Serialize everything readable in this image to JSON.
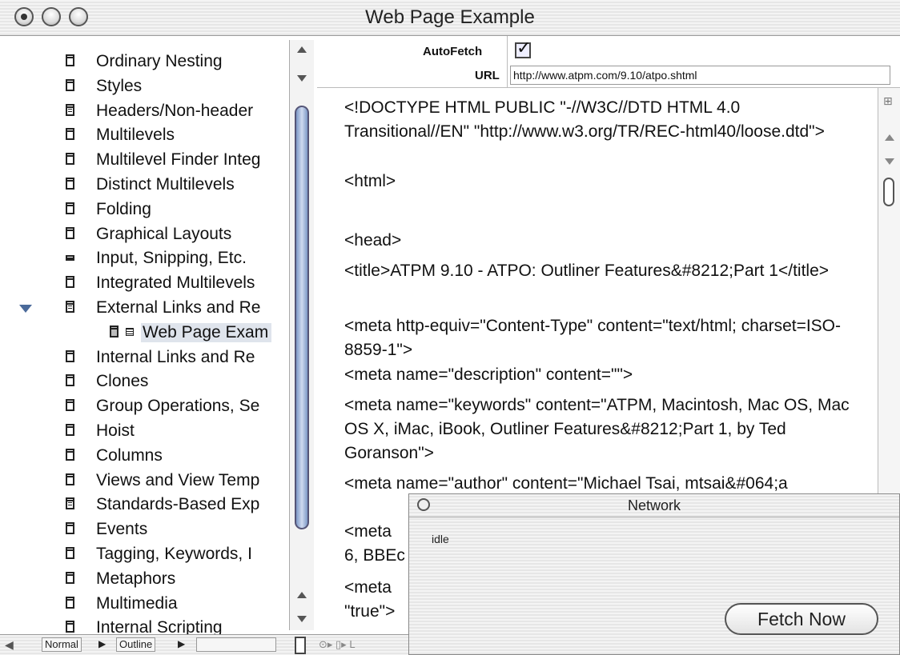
{
  "window": {
    "title": "Web Page Example"
  },
  "outline": {
    "items": [
      {
        "label": "Ordinary Nesting",
        "icon": "document-icon"
      },
      {
        "label": "Styles",
        "icon": "document-icon"
      },
      {
        "label": "Headers/Non-header",
        "icon": "document-filled-icon"
      },
      {
        "label": "Multilevels",
        "icon": "document-icon"
      },
      {
        "label": "Multilevel Finder Integ",
        "icon": "document-icon"
      },
      {
        "label": "Distinct Multilevels",
        "icon": "document-icon"
      },
      {
        "label": "Folding",
        "icon": "document-icon"
      },
      {
        "label": "Graphical Layouts",
        "icon": "document-icon"
      },
      {
        "label": "Input, Snipping, Etc.",
        "icon": "collapsed-document-icon"
      },
      {
        "label": "Integrated Multilevels",
        "icon": "document-icon"
      },
      {
        "label": "External Links and Re",
        "icon": "document-filled-icon",
        "expanded": true
      },
      {
        "label": "Web Page Exam",
        "icon": "web-page-icon",
        "child": true,
        "selected": true
      },
      {
        "label": "Internal Links and Re",
        "icon": "document-icon"
      },
      {
        "label": "Clones",
        "icon": "document-icon"
      },
      {
        "label": "Group Operations, Se",
        "icon": "document-icon"
      },
      {
        "label": "Hoist",
        "icon": "document-icon"
      },
      {
        "label": "Columns",
        "icon": "document-icon"
      },
      {
        "label": "Views and View Temp",
        "icon": "document-icon"
      },
      {
        "label": "Standards-Based Exp",
        "icon": "document-filled-icon"
      },
      {
        "label": "Events",
        "icon": "document-icon"
      },
      {
        "label": "Tagging, Keywords, I",
        "icon": "document-icon"
      },
      {
        "label": "Metaphors",
        "icon": "document-icon"
      },
      {
        "label": "Multimedia",
        "icon": "document-icon"
      },
      {
        "label": "Internal Scripting",
        "icon": "document-icon"
      }
    ]
  },
  "fields": {
    "autofetch_label": "AutoFetch",
    "autofetch_checked": true,
    "url_label": "URL",
    "url_value": "http://www.atpm.com/9.10/atpo.shtml"
  },
  "content": {
    "lines": [
      "<!DOCTYPE HTML PUBLIC \"-//W3C//DTD HTML 4.0 Transitional//EN\" \"http://www.w3.org/TR/REC-html40/loose.dtd\">",
      "<html>",
      "<head>",
      "<title>ATPM 9.10 - ATPO: Outliner Features&#8212;Part 1</title>",
      "<meta http-equiv=\"Content-Type\" content=\"text/html; charset=ISO-8859-1\">",
      "<meta name=\"description\" content=\"\">",
      "<meta name=\"keywords\" content=\"ATPM, Macintosh, Mac OS, Mac OS X, iMac, iBook, Outliner Features&#8212;Part 1, by Ted Goranson\">",
      "<meta name=\"author\" content=\"Michael Tsai, mtsai&#064;a",
      "<meta",
      "6, BBEc",
      "<meta",
      "\"true\">"
    ]
  },
  "bottombar": {
    "view_mode": "Normal",
    "outline_mode": "Outline"
  },
  "network": {
    "title": "Network",
    "status": "idle",
    "fetch_button": "Fetch Now"
  }
}
